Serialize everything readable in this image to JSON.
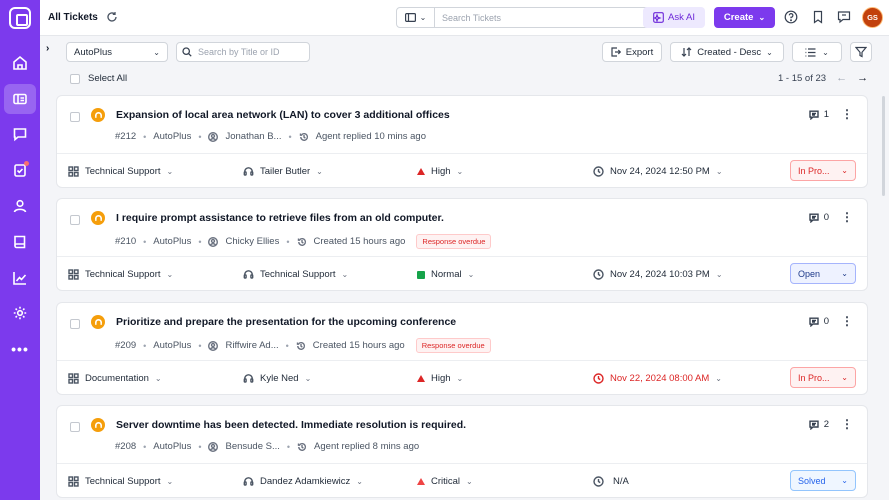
{
  "header": {
    "title": "All Tickets",
    "search_placeholder": "Search Tickets",
    "ask_ai_label": "Ask AI",
    "create_label": "Create",
    "avatar_initials": "GS"
  },
  "toolbar": {
    "company_filter": "AutoPlus",
    "title_search_placeholder": "Search by Title or ID",
    "export_label": "Export",
    "sort_label": "Created - Desc",
    "select_all_label": "Select All",
    "pagination": "1 - 15 of 23"
  },
  "sidebar": {
    "items": [
      "home-icon",
      "tickets-icon",
      "chat-icon",
      "tasks-icon",
      "contacts-icon",
      "knowledge-base-icon",
      "reports-icon",
      "settings-icon",
      "more-icon"
    ]
  },
  "tickets": [
    {
      "title": "Expansion of local area network (LAN) to cover 3 additional offices",
      "id": "#212",
      "company": "AutoPlus",
      "contact": "Jonathan B...",
      "activity": "Agent replied 10 mins ago",
      "overdue": "",
      "comments": "1",
      "category": "Technical Support",
      "agent": "Tailer Butler",
      "priority": "High",
      "date": "Nov 24, 2024 12:50 PM",
      "status": "In Pro..."
    },
    {
      "title": "I require prompt assistance to retrieve files from an old computer.",
      "id": "#210",
      "company": "AutoPlus",
      "contact": "Chicky Ellies",
      "activity": "Created 15 hours ago",
      "overdue": "Response overdue",
      "comments": "0",
      "category": "Technical Support",
      "agent": "Technical Support",
      "priority": "Normal",
      "date": "Nov 24, 2024 10:03 PM",
      "status": "Open"
    },
    {
      "title": "Prioritize and prepare the presentation for the upcoming conference",
      "id": "#209",
      "company": "AutoPlus",
      "contact": "Riffwire Ad...",
      "activity": "Created 15 hours ago",
      "overdue": "Response overdue",
      "comments": "0",
      "category": "Documentation",
      "agent": "Kyle Ned",
      "priority": "High",
      "date": "Nov 22, 2024 08:00 AM",
      "status": "In Pro..."
    },
    {
      "title": "Server downtime has been detected. Immediate resolution is required.",
      "id": "#208",
      "company": "AutoPlus",
      "contact": "Bensude S...",
      "activity": "Agent replied 8 mins ago",
      "overdue": "",
      "comments": "2",
      "category": "Technical Support",
      "agent": "Dandez Adamkiewicz",
      "priority": "Critical",
      "date": "N/A",
      "status": "Solved"
    }
  ],
  "colors": {
    "brand": "#7c3aed",
    "overdue_red": "#dc2626",
    "ticket_icon": "#f59e0b"
  }
}
